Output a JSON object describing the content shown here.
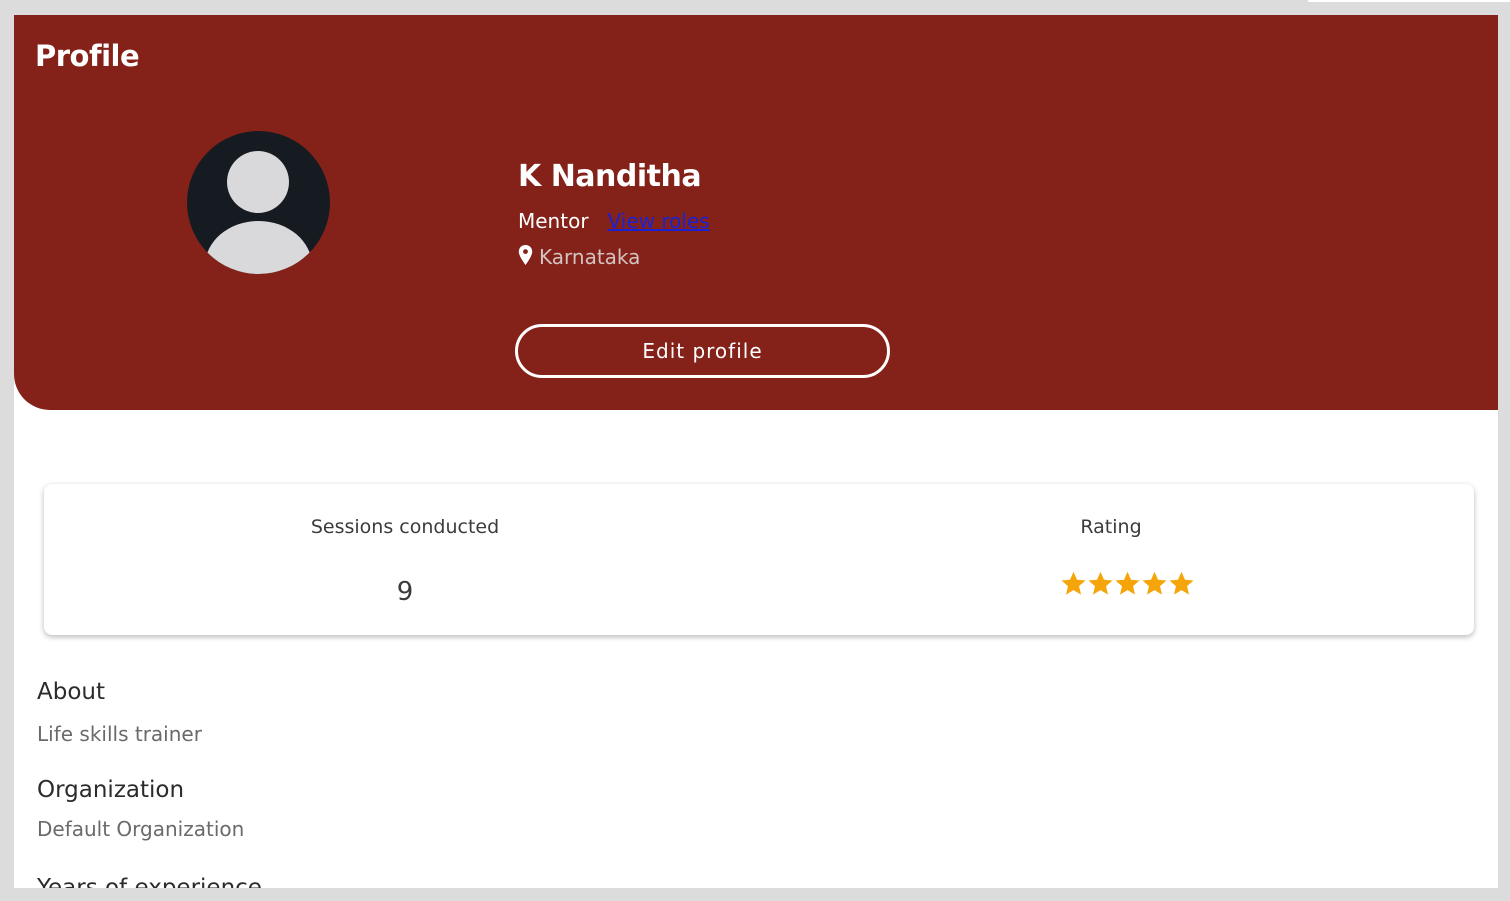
{
  "header": {
    "page_title": "Profile",
    "avatar_icon": "user-avatar-icon",
    "name": "K Nanditha",
    "role": "Mentor",
    "view_roles_label": "View roles",
    "location_icon": "map-pin-icon",
    "location": "Karnataka",
    "edit_profile_label": "Edit profile",
    "background_color": "#84221a"
  },
  "stats": {
    "sessions_label": "Sessions conducted",
    "sessions_value": "9",
    "rating_label": "Rating",
    "rating_stars": 5,
    "rating_max": 5,
    "star_color": "#f5a50a"
  },
  "details": {
    "about_title": "About",
    "about_value": "Life skills trainer",
    "organization_title": "Organization",
    "organization_value": "Default Organization",
    "experience_title": "Years of experience"
  }
}
